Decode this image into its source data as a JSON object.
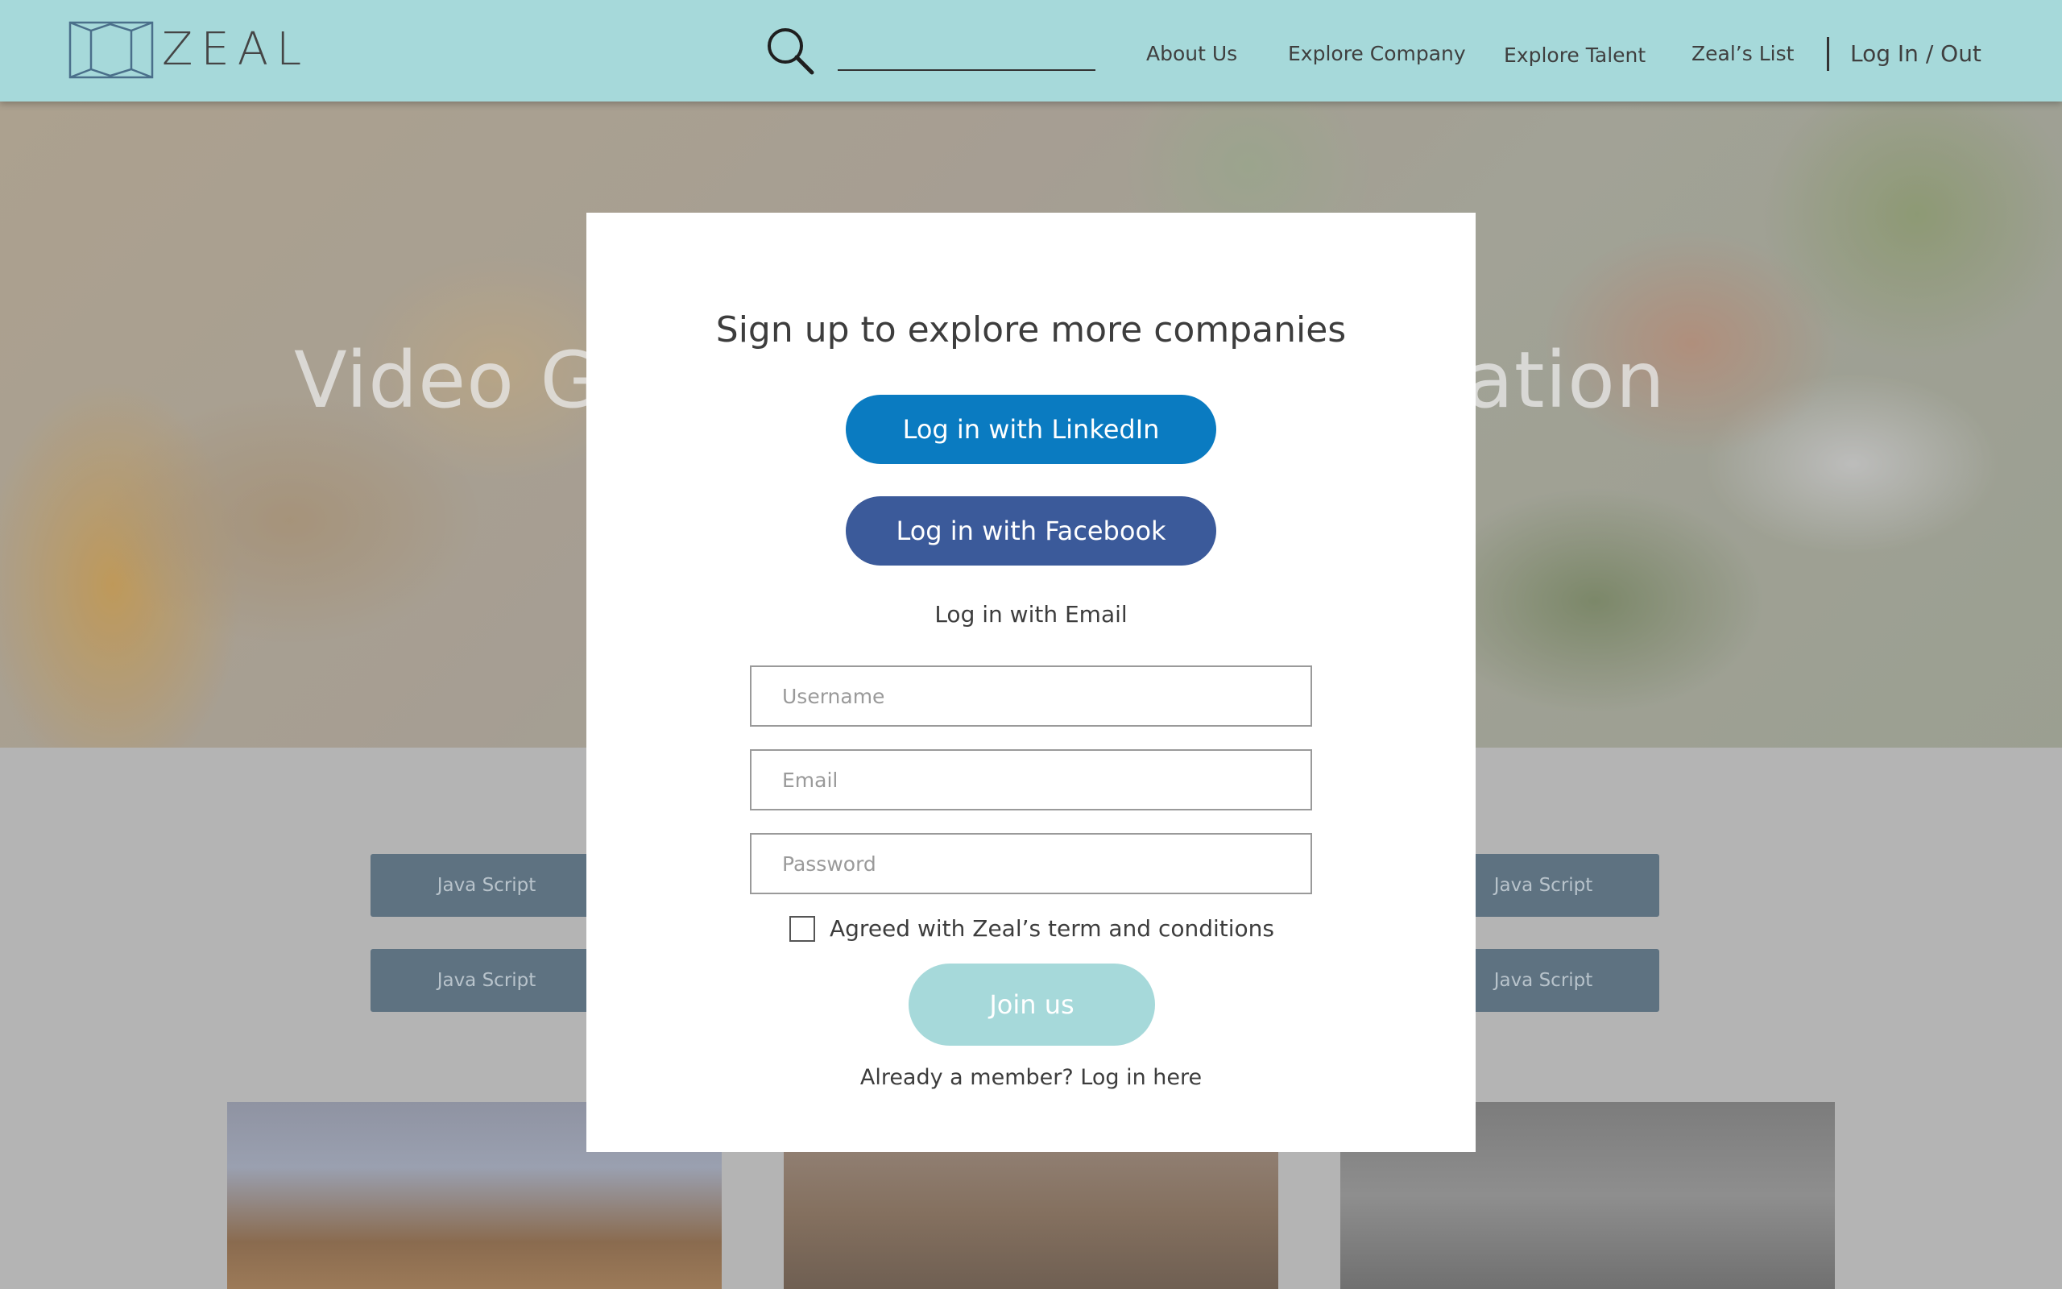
{
  "header": {
    "logo_text": "ZEAL",
    "search_placeholder": "",
    "nav": [
      "About Us",
      "Explore Company",
      "Explore Talent",
      "Zeal’s List"
    ],
    "login_label": "Log In / Out"
  },
  "hero": {
    "title_left": "Video Ga",
    "title_right": "ation"
  },
  "tags": [
    "Java Script",
    "Java Script",
    "Java Script",
    "Java Script"
  ],
  "modal": {
    "title": "Sign up to explore more companies",
    "linkedin_label": "Log in with LinkedIn",
    "facebook_label": "Log in with Facebook",
    "email_label": "Log in with Email",
    "username_placeholder": "Username",
    "email_placeholder": "Email",
    "password_placeholder": "Password",
    "agree_label": "Agreed with Zeal’s term and conditions",
    "join_label": "Join us",
    "member_label": "Already a member? Log in here"
  },
  "colors": {
    "header_bg": "#a6d9da",
    "linkedin": "#0a7bc1",
    "facebook": "#3b5a9a",
    "join": "#a6d9da",
    "tag_bg": "#5e7281"
  }
}
